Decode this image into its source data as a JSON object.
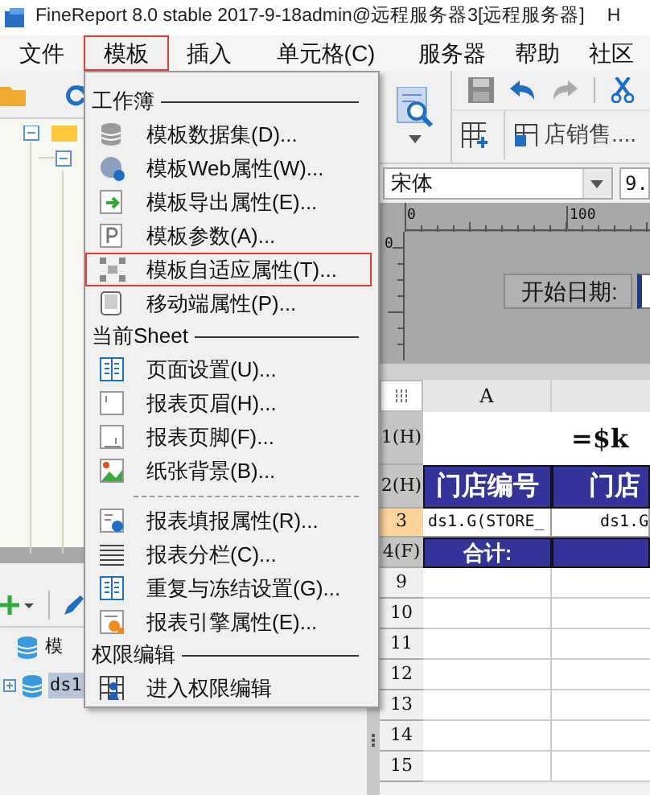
{
  "window": {
    "title": "FineReport 8.0 stable 2017-9-18admin@远程服务器3[远程服务器]",
    "title_tail": "H"
  },
  "menubar": [
    {
      "label": "文件",
      "selected": false
    },
    {
      "label": "模板",
      "selected": true
    },
    {
      "label": "插入",
      "selected": false
    },
    {
      "label": "单元格(C)",
      "selected": false
    },
    {
      "label": "服务器",
      "selected": false
    },
    {
      "label": "帮助",
      "selected": false
    },
    {
      "label": "社区",
      "selected": false
    }
  ],
  "dropdown": {
    "sections": [
      {
        "kind": "titled",
        "title": "工作簿",
        "items": [
          {
            "label": "模板数据集(D)...",
            "highlighted": false
          },
          {
            "label": "模板Web属性(W)...",
            "highlighted": false
          },
          {
            "label": "模板导出属性(E)...",
            "highlighted": false
          },
          {
            "label": "模板参数(A)...",
            "highlighted": false
          },
          {
            "label": "模板自适应属性(T)...",
            "highlighted": true
          },
          {
            "label": "移动端属性(P)...",
            "highlighted": false
          }
        ]
      },
      {
        "kind": "titled",
        "title": "当前Sheet",
        "items": [
          {
            "label": "页面设置(U)...",
            "highlighted": false
          },
          {
            "label": "报表页眉(H)...",
            "highlighted": false
          },
          {
            "label": "报表页脚(F)...",
            "highlighted": false
          },
          {
            "label": "纸张背景(B)...",
            "highlighted": false
          }
        ]
      },
      {
        "kind": "dashed",
        "items": [
          {
            "label": "报表填报属性(R)...",
            "highlighted": false
          },
          {
            "label": "报表分栏(C)...",
            "highlighted": false
          },
          {
            "label": "重复与冻结设置(G)...",
            "highlighted": false
          },
          {
            "label": "报表引擎属性(E)...",
            "highlighted": false
          }
        ]
      },
      {
        "kind": "titled",
        "title": "权限编辑",
        "items": [
          {
            "label": "进入权限编辑",
            "highlighted": false
          }
        ]
      }
    ]
  },
  "left_panel": {
    "tree_items": [
      {
        "label": "模",
        "selected": false
      },
      {
        "label": "ds1",
        "selected": true
      }
    ]
  },
  "editor": {
    "tab": "店销售....",
    "font_field": {
      "value": "宋体"
    },
    "size_field": {
      "value": "9."
    },
    "ruler_marks": [
      "0",
      "100"
    ],
    "side_ruler_mark": "0",
    "form_label": "开始日期:",
    "sheet": {
      "columns": [
        "A"
      ],
      "rows": [
        {
          "kind": "title",
          "header": "1(H)",
          "selected": false,
          "cells": [
            "",
            "=$k"
          ]
        },
        {
          "kind": "head",
          "header": "2(H)",
          "selected": false,
          "cells": [
            "门店编号",
            "门店"
          ]
        },
        {
          "kind": "data",
          "header": "3",
          "selected": true,
          "cells": [
            "ds1.G(STORE_",
            "ds1.G"
          ]
        },
        {
          "kind": "foot",
          "header": "4(F)",
          "selected": false,
          "cells": [
            "合计:"
          ]
        },
        {
          "kind": "blank",
          "header": "9",
          "selected": false,
          "cells": []
        },
        {
          "kind": "blank",
          "header": "10",
          "selected": false,
          "cells": []
        },
        {
          "kind": "blank",
          "header": "11",
          "selected": false,
          "cells": []
        },
        {
          "kind": "blank",
          "header": "12",
          "selected": false,
          "cells": []
        },
        {
          "kind": "blank",
          "header": "13",
          "selected": false,
          "cells": []
        },
        {
          "kind": "blank",
          "header": "14",
          "selected": false,
          "cells": []
        },
        {
          "kind": "blank",
          "header": "15",
          "selected": false,
          "cells": []
        }
      ]
    }
  }
}
